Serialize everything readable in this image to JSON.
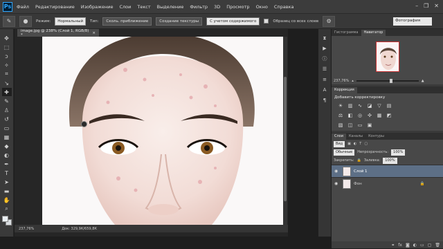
{
  "menu": {
    "logo": "Ps",
    "items": [
      "Файл",
      "Редактирование",
      "Изображение",
      "Слои",
      "Текст",
      "Выделение",
      "Фильтр",
      "3D",
      "Просмотр",
      "Окно",
      "Справка"
    ]
  },
  "options": {
    "mode_label": "Режим:",
    "mode_value": "Нормальный",
    "type_label": "Тип:",
    "btn_blend": "Сколь. приближение",
    "btn_texture": "Создание текстуры",
    "btn_content": "С учетом содержимого",
    "sample_all": "Образец со всех слоев",
    "workspace": "Фотография"
  },
  "document": {
    "tab_title": "image.jpg @ 238% (Слой 1, RGB/8) *",
    "zoom": "237,76%",
    "doc_size": "Док: 329,9К/659,8К"
  },
  "panels": {
    "tab_histogram": "Гистограмма",
    "tab_navigator": "Навигатор",
    "nav_zoom": "237,76%",
    "corrections_tab": "Коррекция",
    "add_adjustment": "Добавить корректировку",
    "tab_layers": "Слои",
    "tab_channels": "Каналы",
    "tab_paths": "Контуры",
    "kind": "Вид",
    "blend_mode": "Обычные",
    "opacity_label": "Непрозрачность:",
    "opacity_value": "100%",
    "lock_label": "Закрепить:",
    "fill_label": "Заливка:",
    "fill_value": "100%",
    "layers": [
      {
        "name": "Слой 1",
        "selected": true
      },
      {
        "name": "Фон",
        "selected": false
      }
    ]
  }
}
